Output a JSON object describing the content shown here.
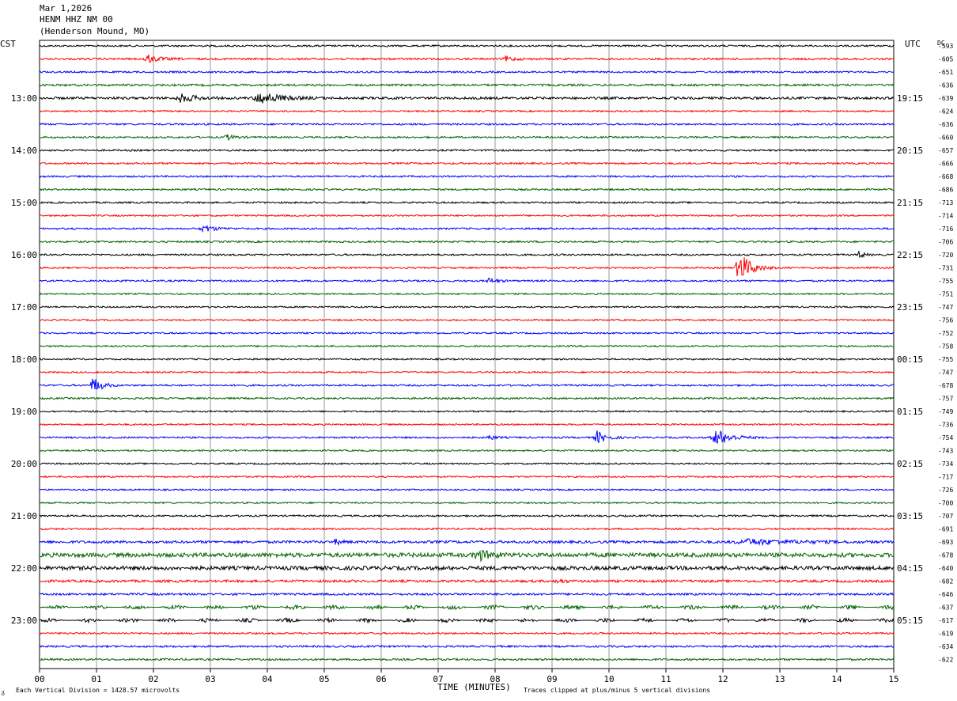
{
  "header": {
    "date": "Mar 1,2026",
    "station": "HENM HHZ NM 00",
    "location": "(Henderson Mound, MO)"
  },
  "left_zone": "CST",
  "right_zone": "UTC",
  "dc_header": "DC",
  "footer": {
    "scale_note": "Each Vertical Division = 1428.57 microvolts",
    "clip_note": "Traces clipped at plus/minus 5 vertical divisions",
    "corner_mark": "ᵹ"
  },
  "colors": {
    "trace_cycle": [
      "#000000",
      "#ff0000",
      "#0000ff",
      "#006400"
    ],
    "grid": "#9a9a9a"
  },
  "chart_data": {
    "type": "line",
    "title": "Mar 1,2026 HENM HHZ NM 00 (Henderson Mound, MO)",
    "xlabel": "TIME (MINUTES)",
    "xlim": [
      0,
      15
    ],
    "x_ticks": [
      "00",
      "01",
      "02",
      "03",
      "04",
      "05",
      "06",
      "07",
      "08",
      "09",
      "10",
      "11",
      "12",
      "13",
      "14",
      "15"
    ],
    "rows_per_hour": 4,
    "minutes_per_row": 15,
    "left_time_labels": [
      {
        "row": 4,
        "label": "13:00"
      },
      {
        "row": 8,
        "label": "14:00"
      },
      {
        "row": 12,
        "label": "15:00"
      },
      {
        "row": 16,
        "label": "16:00"
      },
      {
        "row": 20,
        "label": "17:00"
      },
      {
        "row": 24,
        "label": "18:00"
      },
      {
        "row": 28,
        "label": "19:00"
      },
      {
        "row": 32,
        "label": "20:00"
      },
      {
        "row": 36,
        "label": "21:00"
      },
      {
        "row": 40,
        "label": "22:00"
      },
      {
        "row": 44,
        "label": "23:00"
      }
    ],
    "right_time_labels": [
      {
        "row": 4,
        "label": "19:15"
      },
      {
        "row": 8,
        "label": "20:15"
      },
      {
        "row": 12,
        "label": "21:15"
      },
      {
        "row": 16,
        "label": "22:15"
      },
      {
        "row": 20,
        "label": "23:15"
      },
      {
        "row": 24,
        "label": "00:15"
      },
      {
        "row": 28,
        "label": "01:15"
      },
      {
        "row": 32,
        "label": "02:15"
      },
      {
        "row": 36,
        "label": "03:15"
      },
      {
        "row": 40,
        "label": "04:15"
      },
      {
        "row": 44,
        "label": "05:15"
      }
    ],
    "dc_offsets": [
      "-593",
      "-605",
      "-651",
      "-636",
      "-639",
      "-624",
      "-636",
      "-660",
      "-657",
      "-666",
      "-668",
      "-686",
      "-713",
      "-714",
      "-716",
      "-706",
      "-720",
      "-731",
      "-755",
      "-751",
      "-747",
      "-756",
      "-752",
      "-758",
      "-755",
      "-747",
      "-678",
      "-757",
      "-749",
      "-736",
      "-754",
      "-743",
      "-734",
      "-717",
      "-726",
      "-700",
      "-707",
      "-691",
      "-693",
      "-678",
      "-640",
      "-682",
      "-646",
      "-637",
      "-617",
      "-619",
      "-634",
      "-622"
    ],
    "row_noise": [
      1.0,
      1.1,
      1.0,
      1.2,
      1.4,
      0.9,
      1.0,
      1.0,
      1.0,
      1.0,
      1.0,
      1.0,
      1.0,
      0.9,
      1.0,
      1.0,
      1.0,
      0.9,
      1.0,
      0.9,
      0.9,
      0.9,
      0.9,
      0.9,
      0.9,
      0.9,
      1.0,
      1.0,
      0.9,
      0.9,
      1.0,
      0.9,
      0.9,
      0.9,
      0.9,
      0.9,
      1.0,
      1.0,
      1.5,
      2.4,
      2.2,
      1.4,
      1.2,
      1.3,
      1.1,
      1.0,
      1.1,
      1.1
    ],
    "events": [
      {
        "row": 1,
        "minute": 1.9,
        "amp": 5,
        "dur": 0.4
      },
      {
        "row": 1,
        "minute": 8.2,
        "amp": 3,
        "dur": 0.3
      },
      {
        "row": 4,
        "minute": 2.5,
        "amp": 5,
        "dur": 0.5
      },
      {
        "row": 4,
        "minute": 3.9,
        "amp": 7,
        "dur": 0.7
      },
      {
        "row": 7,
        "minute": 3.3,
        "amp": 3,
        "dur": 0.3
      },
      {
        "row": 14,
        "minute": 2.9,
        "amp": 4,
        "dur": 0.4
      },
      {
        "row": 16,
        "minute": 14.4,
        "amp": 5,
        "dur": 0.15
      },
      {
        "row": 17,
        "minute": 12.3,
        "amp": 20,
        "dur": 0.4
      },
      {
        "row": 18,
        "minute": 7.9,
        "amp": 3,
        "dur": 0.3
      },
      {
        "row": 26,
        "minute": 0.95,
        "amp": 10,
        "dur": 0.3
      },
      {
        "row": 30,
        "minute": 7.9,
        "amp": 3,
        "dur": 0.2
      },
      {
        "row": 30,
        "minute": 9.8,
        "amp": 8,
        "dur": 0.3
      },
      {
        "row": 30,
        "minute": 11.9,
        "amp": 10,
        "dur": 0.5
      },
      {
        "row": 38,
        "minute": 5.2,
        "amp": 3,
        "dur": 0.2
      },
      {
        "row": 38,
        "minute": 12.5,
        "amp": 3,
        "dur": 1.5
      },
      {
        "row": 39,
        "minute": 7.7,
        "amp": 7,
        "dur": 0.4
      },
      {
        "row": 41,
        "minute": 9.1,
        "amp": 3,
        "dur": 0.2
      }
    ]
  }
}
